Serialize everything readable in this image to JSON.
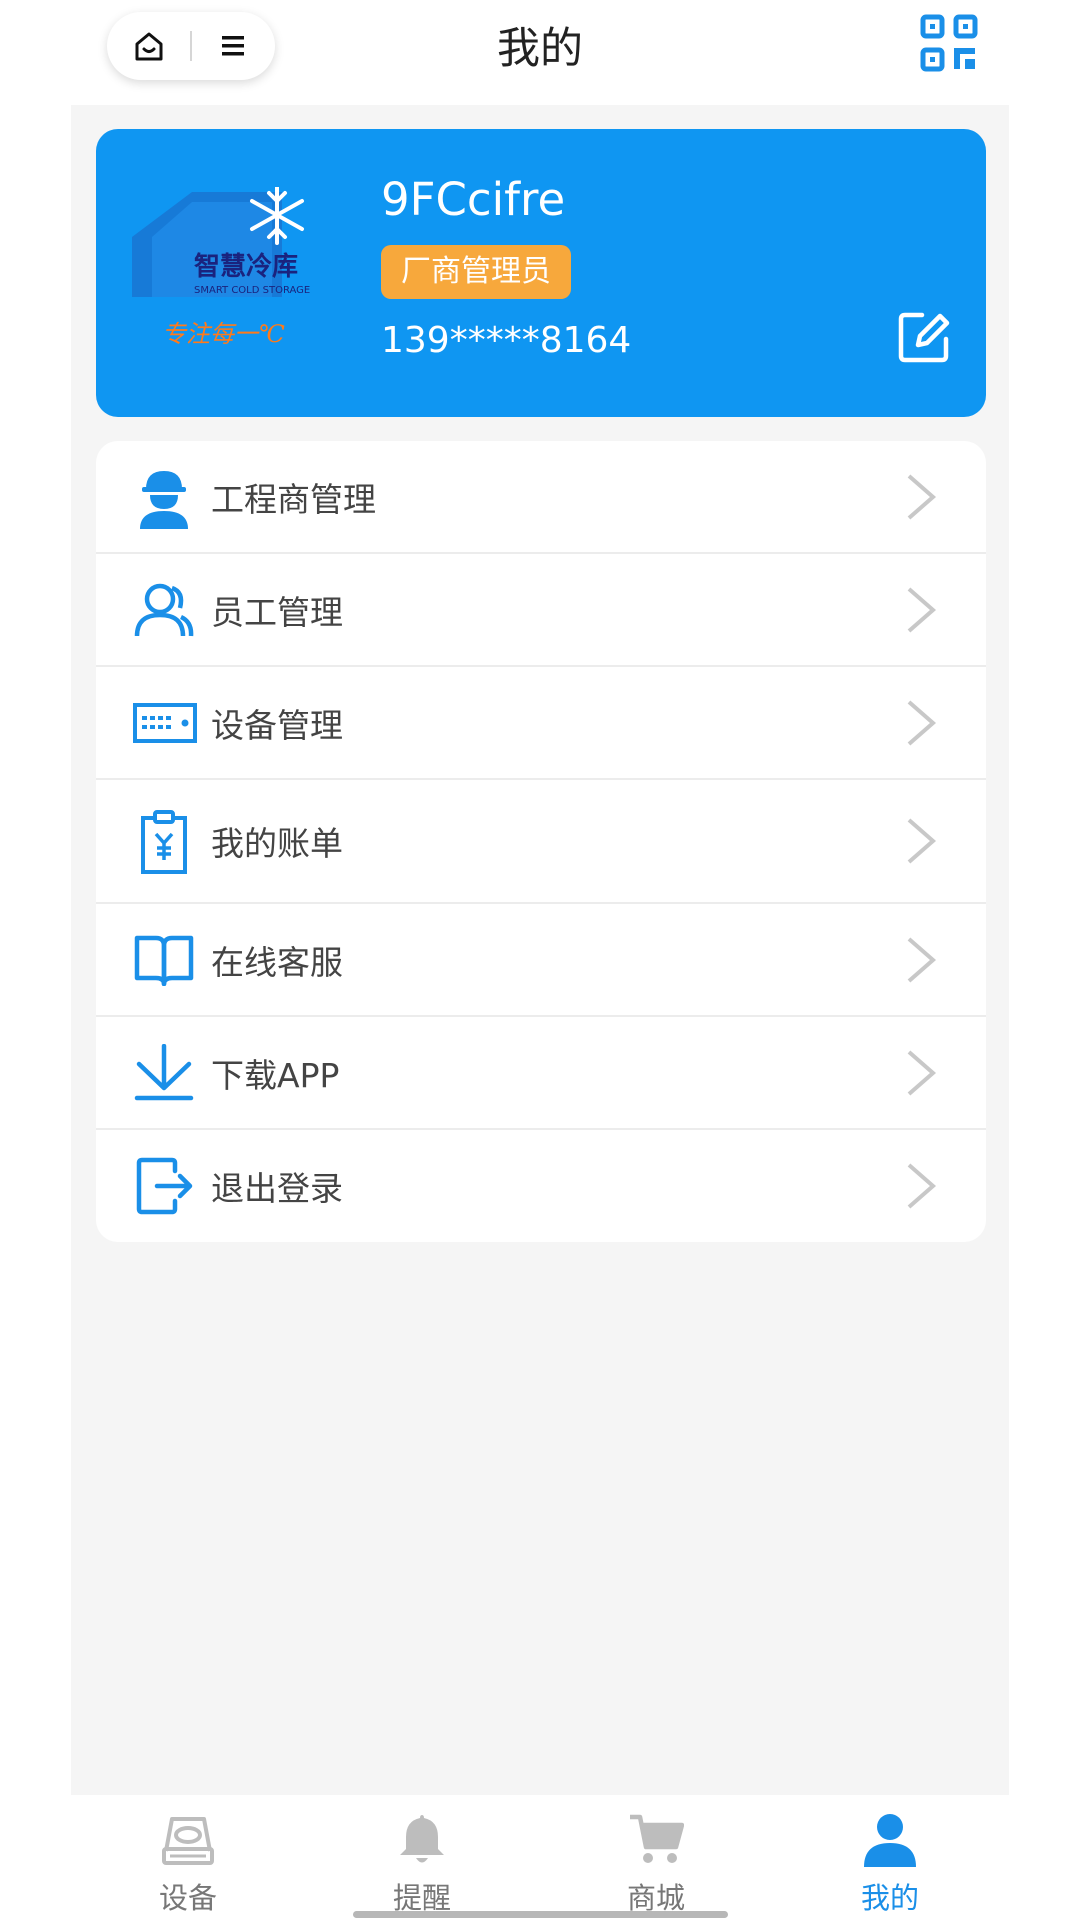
{
  "header": {
    "title": "我的",
    "capsule_home_icon": "home-icon",
    "capsule_menu_icon": "menu-icon",
    "qr_icon": "qr-code-icon"
  },
  "profile": {
    "logo_text": "智慧冷库",
    "logo_subtext": "SMART COLD STORAGE",
    "logo_slogan": "专注每一℃",
    "username": "9FCcifre",
    "role": "厂商管理员",
    "phone": "139*****8164",
    "edit_icon": "edit-icon"
  },
  "menu": {
    "items": [
      {
        "label": "工程商管理",
        "icon": "engineer-icon"
      },
      {
        "label": "员工管理",
        "icon": "staff-icon"
      },
      {
        "label": "设备管理",
        "icon": "device-icon"
      },
      {
        "label": "我的账单",
        "icon": "bill-icon"
      },
      {
        "label": "在线客服",
        "icon": "book-icon"
      },
      {
        "label": "下载APP",
        "icon": "download-icon"
      },
      {
        "label": "退出登录",
        "icon": "logout-icon"
      }
    ]
  },
  "tabbar": {
    "items": [
      {
        "label": "设备",
        "icon": "device-tab-icon",
        "active": false
      },
      {
        "label": "提醒",
        "icon": "bell-icon",
        "active": false
      },
      {
        "label": "商城",
        "icon": "cart-icon",
        "active": false
      },
      {
        "label": "我的",
        "icon": "user-icon",
        "active": true
      }
    ]
  },
  "colors": {
    "accent": "#0f96f2",
    "badge": "#f7a83c",
    "icon_blue": "#1a8fe8",
    "tab_inactive": "#bdbdbd",
    "background": "#f5f5f5"
  }
}
